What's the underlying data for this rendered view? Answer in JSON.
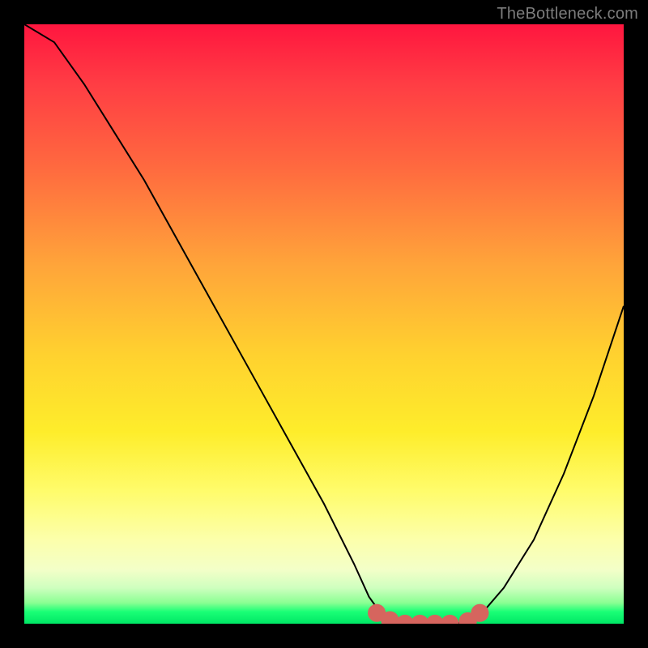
{
  "watermark": "TheBottleneck.com",
  "chart_data": {
    "type": "line",
    "title": "",
    "xlabel": "",
    "ylabel": "",
    "xlim": [
      0,
      1
    ],
    "ylim": [
      0,
      1
    ],
    "series": [
      {
        "name": "bottleneck-curve",
        "x": [
          0.0,
          0.05,
          0.1,
          0.15,
          0.2,
          0.25,
          0.3,
          0.35,
          0.4,
          0.45,
          0.5,
          0.55,
          0.575,
          0.6,
          0.64,
          0.68,
          0.72,
          0.75,
          0.77,
          0.8,
          0.85,
          0.9,
          0.95,
          1.0
        ],
        "values": [
          1.0,
          0.97,
          0.9,
          0.82,
          0.74,
          0.65,
          0.56,
          0.47,
          0.38,
          0.29,
          0.2,
          0.1,
          0.045,
          0.01,
          0.0,
          0.0,
          0.0,
          0.008,
          0.025,
          0.06,
          0.14,
          0.25,
          0.38,
          0.53
        ]
      }
    ],
    "markers": {
      "x": [
        0.588,
        0.61,
        0.635,
        0.66,
        0.685,
        0.71,
        0.74,
        0.76
      ],
      "values": [
        0.018,
        0.006,
        0.0,
        0.0,
        0.0,
        0.0,
        0.004,
        0.018
      ],
      "color": "#d6655e",
      "radius_norm": 0.015
    },
    "gradient_stops": [
      {
        "pos": 0.0,
        "color": "#ff163f"
      },
      {
        "pos": 0.1,
        "color": "#ff3d44"
      },
      {
        "pos": 0.24,
        "color": "#ff6a3f"
      },
      {
        "pos": 0.4,
        "color": "#ffa43a"
      },
      {
        "pos": 0.55,
        "color": "#ffd12f"
      },
      {
        "pos": 0.68,
        "color": "#feed2b"
      },
      {
        "pos": 0.78,
        "color": "#fffc6c"
      },
      {
        "pos": 0.86,
        "color": "#fcffab"
      },
      {
        "pos": 0.91,
        "color": "#f3ffc8"
      },
      {
        "pos": 0.94,
        "color": "#cfffbf"
      },
      {
        "pos": 0.965,
        "color": "#8bff93"
      },
      {
        "pos": 0.98,
        "color": "#1aff76"
      },
      {
        "pos": 1.0,
        "color": "#00e765"
      }
    ]
  }
}
